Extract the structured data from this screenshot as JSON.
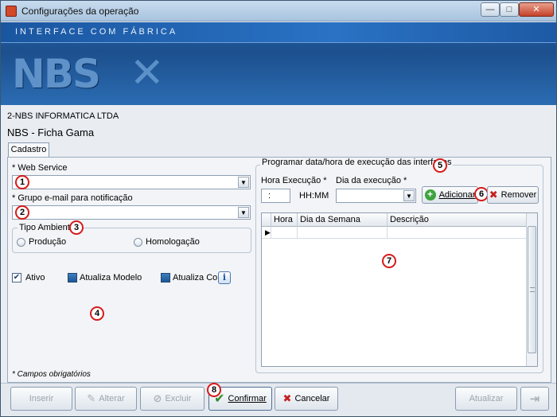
{
  "window": {
    "title": "Configurações da operação",
    "minimize_label": "—",
    "maximize_label": "□",
    "close_label": "✕"
  },
  "banner": {
    "strip_text": "INTERFACE COM FÁBRICA",
    "logo_text": "NBS"
  },
  "header": {
    "company": "2-NBS INFORMATICA LTDA",
    "operation": "NBS - Ficha Gama"
  },
  "tabs": [
    {
      "label": "Cadastro"
    }
  ],
  "form": {
    "web_service_label": "* Web Service",
    "web_service_value": "",
    "email_group_label": "* Grupo e-mail para notificação",
    "email_group_value": "",
    "environment": {
      "legend": "Tipo Ambiente",
      "options": [
        "Produção",
        "Homologação"
      ]
    },
    "checkboxes": {
      "ativo": {
        "label": "Ativo",
        "checked": true
      },
      "atualiza_modelo": {
        "label": "Atualiza Modelo",
        "checked": true
      },
      "atualiza_cor": {
        "label": "Atualiza Cor",
        "checked": true
      }
    },
    "required_note": "* Campos obrigatórios"
  },
  "schedule": {
    "legend": "Programar data/hora de execução das interfaces",
    "time_label": "Hora Execução *",
    "time_value": ":",
    "time_format": "HH:MM",
    "day_label": "Dia da execução *",
    "day_value": "",
    "add_label": "Adicionar",
    "remove_label": "Remover",
    "columns": [
      "Hora",
      "Dia da Semana",
      "Descrição"
    ],
    "rows": []
  },
  "markers": [
    "1",
    "2",
    "3",
    "4",
    "5",
    "6",
    "7",
    "8"
  ],
  "toolbar": {
    "inserir": "Inserir",
    "alterar": "Alterar",
    "excluir": "Excluir",
    "confirmar": "Confirmar",
    "cancelar": "Cancelar",
    "atualizar": "Atualizar"
  },
  "icons": {
    "info": "i",
    "grid_indicator": "▶",
    "combo_arrow": "▼",
    "add": "+",
    "remove": "✖",
    "confirm": "✔",
    "cancel": "✖",
    "exit": "⇥"
  },
  "colors": {
    "banner_blue": "#1c4f8d",
    "marker_red": "#d61a1a",
    "confirm_green": "#2d8a2d",
    "cancel_red": "#c42020"
  }
}
